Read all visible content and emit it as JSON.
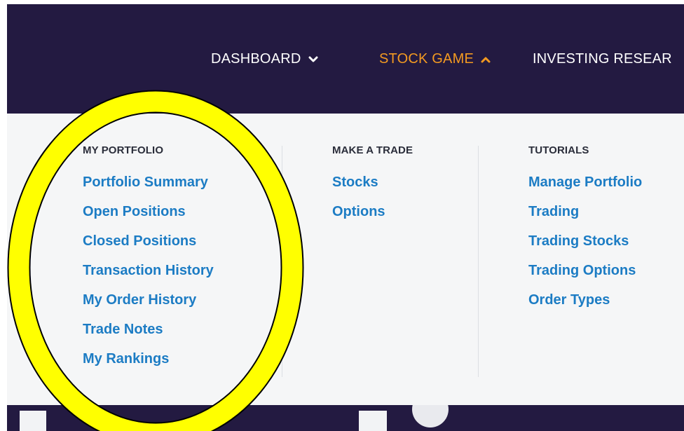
{
  "topnav": {
    "items": [
      {
        "label": "DASHBOARD",
        "state": "collapsed",
        "chevron": "chevron-down-icon"
      },
      {
        "label": "STOCK GAME",
        "state": "expanded",
        "chevron": "chevron-up-icon"
      },
      {
        "label": "INVESTING RESEAR"
      }
    ]
  },
  "menu": {
    "columns": [
      {
        "heading": "MY PORTFOLIO",
        "links": [
          "Portfolio Summary",
          "Open Positions",
          "Closed Positions",
          "Transaction History",
          "My Order History",
          "Trade Notes",
          "My Rankings"
        ]
      },
      {
        "heading": "MAKE A TRADE",
        "links": [
          "Stocks",
          "Options"
        ]
      },
      {
        "heading": "TUTORIALS",
        "links": [
          "Manage Portfolio",
          "Trading",
          "Trading Stocks",
          "Trading Options",
          "Order Types"
        ]
      }
    ]
  },
  "colors": {
    "nav_bg": "#231a41",
    "accent": "#f39a21",
    "link": "#1c7cc4",
    "annotation_fill": "#ffff00"
  },
  "annotation": {
    "shape": "ellipse",
    "target": "MY PORTFOLIO column"
  }
}
